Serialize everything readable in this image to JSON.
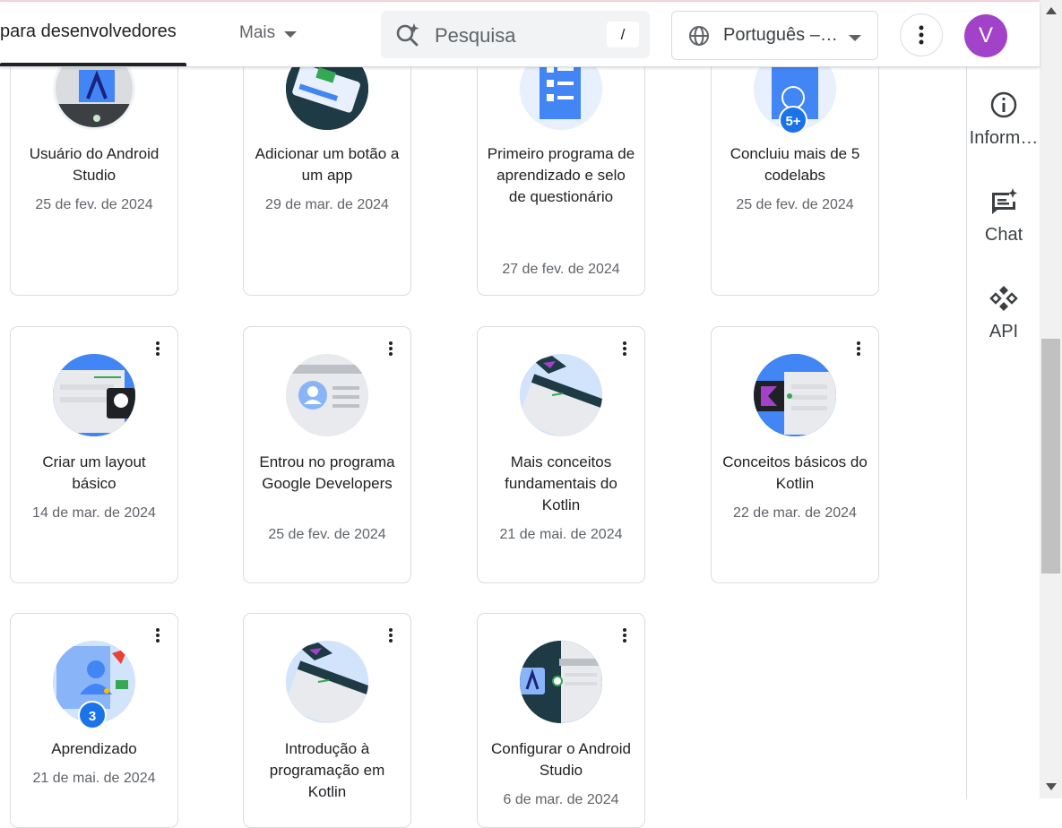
{
  "header": {
    "active_nav": "para desenvolvedores",
    "more_label": "Mais",
    "search_placeholder": "Pesquisa",
    "search_shortcut": "/",
    "language": "Português –…",
    "avatar_initial": "V"
  },
  "rail": {
    "items": [
      {
        "label": "Inform…",
        "icon": "info-icon"
      },
      {
        "label": "Chat",
        "icon": "chat-spark-icon"
      },
      {
        "label": "API",
        "icon": "api-icon"
      }
    ]
  },
  "badges": [
    {
      "title": "Usuário do Android Studio",
      "date": "25 de fev. de 2024"
    },
    {
      "title": "Adicionar um botão a um app",
      "date": "29 de mar. de 2024"
    },
    {
      "title": "Primeiro programa de aprendizado e selo de questionário",
      "date": "27 de fev. de 2024"
    },
    {
      "title": "Concluiu mais de 5 codelabs",
      "date": "25 de fev. de 2024",
      "count": "5+"
    },
    {
      "title": "Criar um layout básico",
      "date": "14 de mar. de 2024"
    },
    {
      "title": "Entrou no programa Google Developers",
      "date": "25 de fev. de 2024"
    },
    {
      "title": "Mais conceitos fundamentais do Kotlin",
      "date": "21 de mai. de 2024"
    },
    {
      "title": "Conceitos básicos do Kotlin",
      "date": "22 de mar. de 2024"
    },
    {
      "title": "Aprendizado",
      "date": "21 de mai. de 2024",
      "count": "3"
    },
    {
      "title": "Introdução à programação em Kotlin",
      "date": ""
    },
    {
      "title": "Configurar o Android Studio",
      "date": "6 de mar. de 2024"
    }
  ],
  "colors": {
    "accent": "#1a73e8",
    "avatar": "#a142c9",
    "dark_teal": "#1e3a45"
  }
}
